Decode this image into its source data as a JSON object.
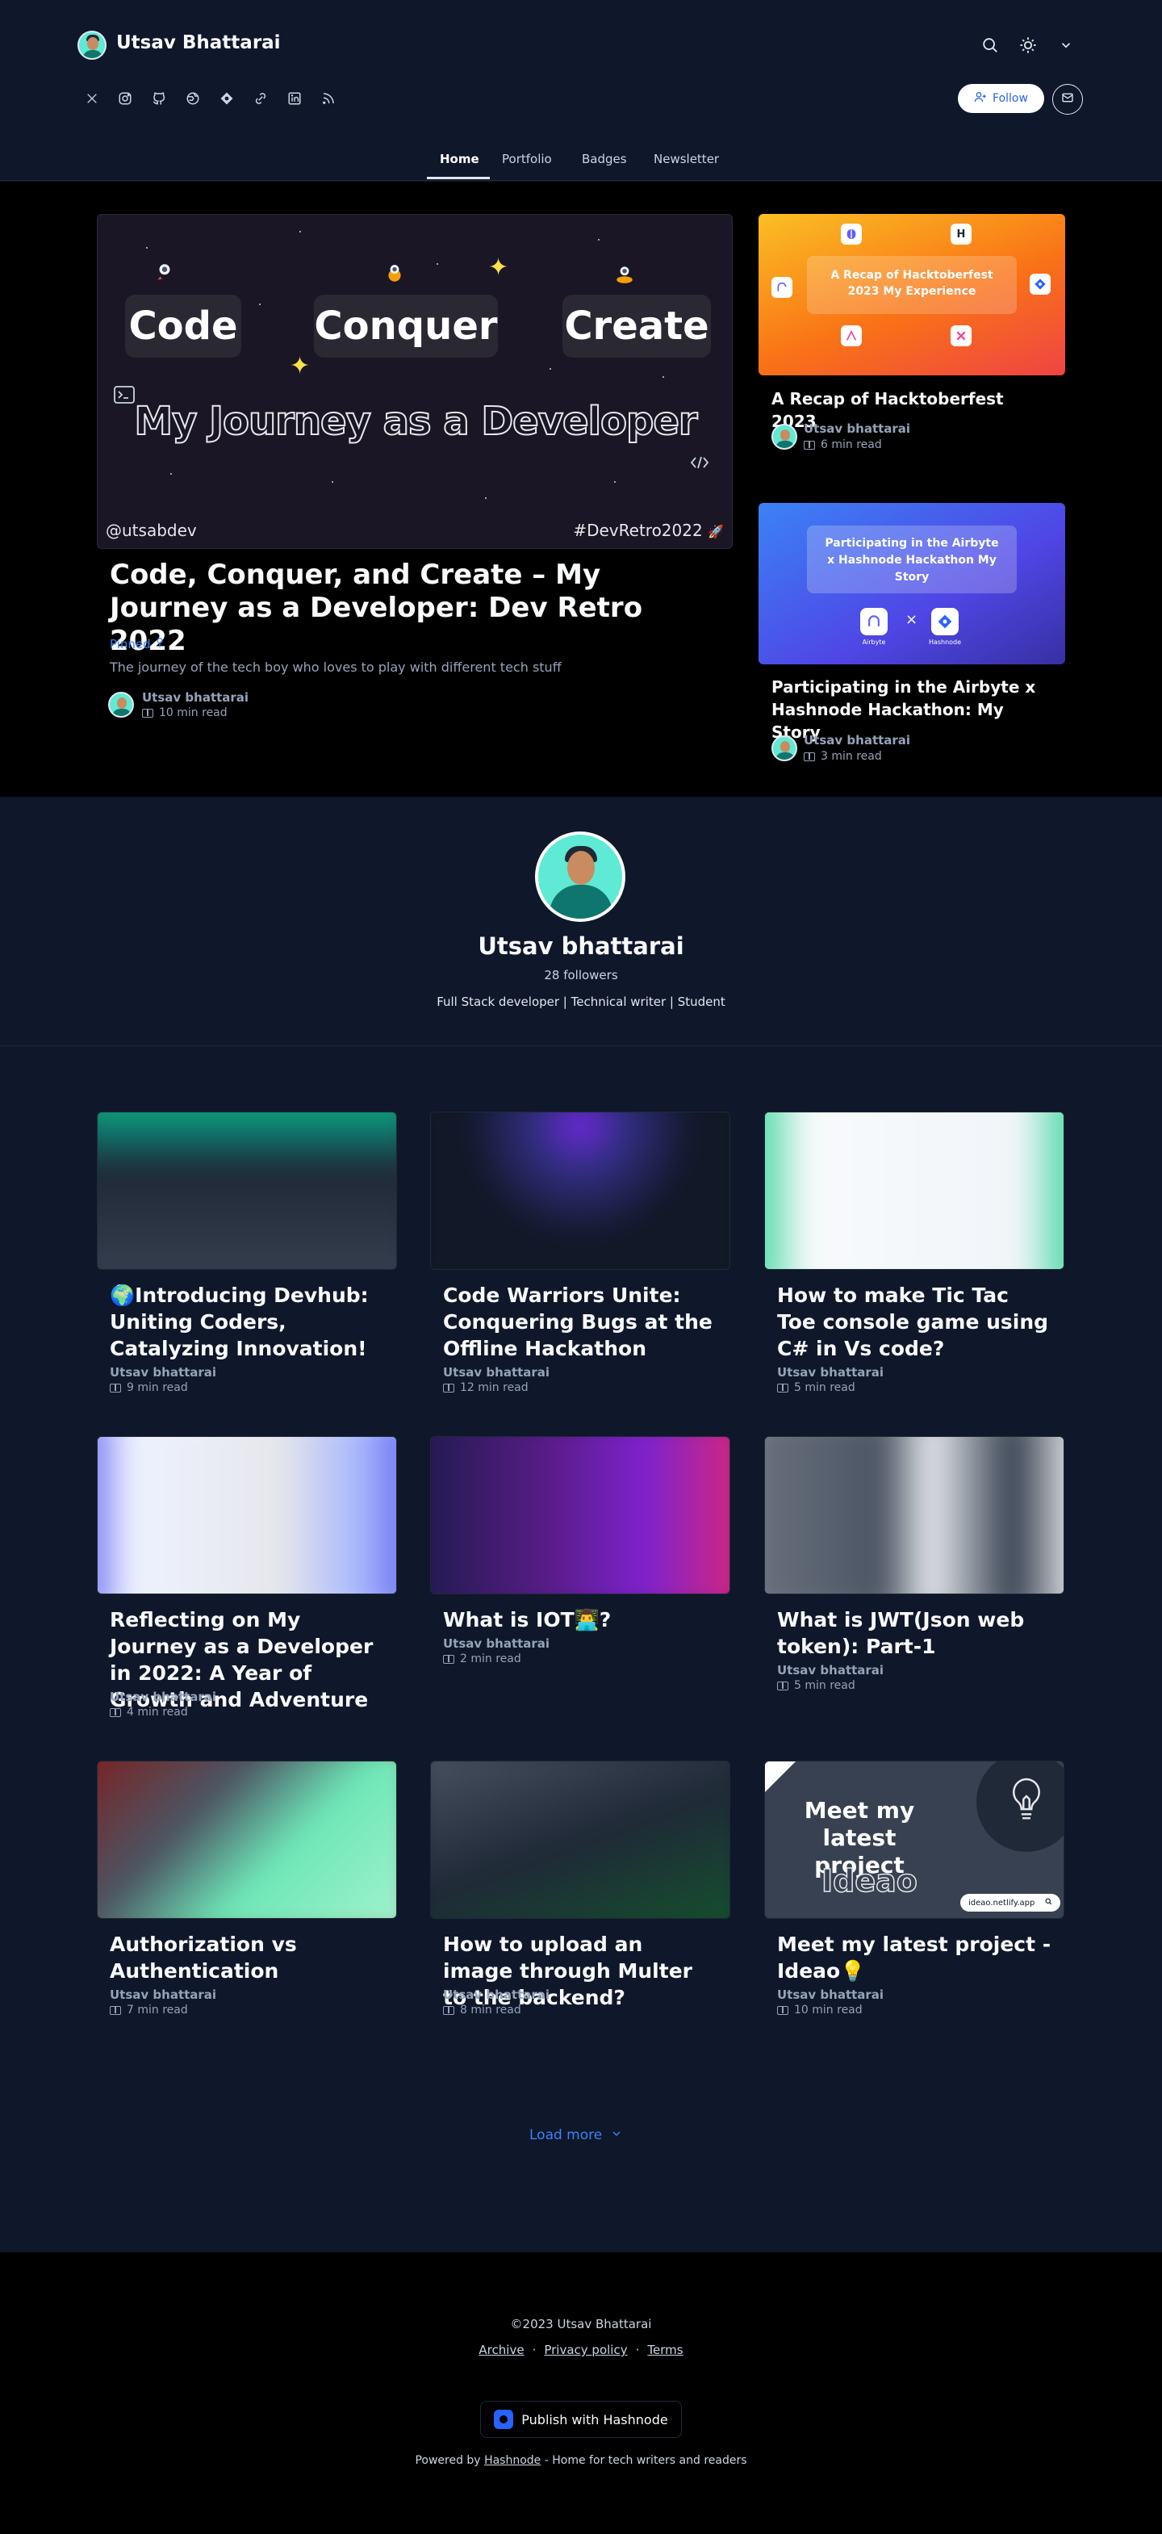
{
  "header": {
    "blog_title": "Utsav Bhattarai",
    "follow_label": "Follow",
    "nav": [
      "Home",
      "Portfolio",
      "Badges",
      "Newsletter"
    ]
  },
  "featured_main": {
    "image": {
      "words": [
        "Code",
        "Conquer",
        "Create"
      ],
      "headline": "My Journey as a Developer",
      "handle": "@utsabdev",
      "tag": "#DevRetro2022"
    },
    "title": "Code, Conquer, and Create – My Journey as a Developer: Dev Retro 2022",
    "pinned": "Pinned",
    "subtitle": "The journey of the tech boy who loves to play with different tech stuff",
    "author": "Utsav bhattarai",
    "read_time": "10 min read"
  },
  "featured_side": [
    {
      "image_text": "A Recap of Hacktoberfest 2023 My Experience",
      "title": "A Recap of Hacktoberfest 2023",
      "author": "Utsav bhattarai",
      "read_time": "6 min read"
    },
    {
      "image_text": "Participating in the Airbyte x Hashnode Hackathon My Story",
      "image_logos": [
        "Airbyte",
        "Hashnode"
      ],
      "title": "Participating in the Airbyte x Hashnode Hackathon: My Story",
      "author": "Utsav bhattarai",
      "read_time": "3 min read"
    }
  ],
  "profile": {
    "name": "Utsav bhattarai",
    "followers": "28 followers",
    "bio": "Full Stack developer | Technical writer | Student"
  },
  "posts": [
    {
      "title": "🌍Introducing Devhub: Uniting Coders, Catalyzing Innovation!",
      "author": "Utsav bhattarai",
      "read_time": "9 min read"
    },
    {
      "title": "Code Warriors Unite: Conquering Bugs at the Offline Hackathon",
      "author": "Utsav bhattarai",
      "read_time": "12 min read"
    },
    {
      "title": "How to make Tic Tac Toe console game using C# in Vs code?",
      "author": "Utsav bhattarai",
      "read_time": "5 min read"
    },
    {
      "title": "Reflecting on My Journey as a Developer in 2022: A Year of Growth and Adventure",
      "author": "Utsav bhattarai",
      "read_time": "4 min read"
    },
    {
      "title": "What is IOT👨‍💻?",
      "author": "Utsav bhattarai",
      "read_time": "2 min read"
    },
    {
      "title": "What is JWT(Json web token): Part-1",
      "author": "Utsav bhattarai",
      "read_time": "5 min read"
    },
    {
      "title": "Authorization vs Authentication",
      "author": "Utsav bhattarai",
      "read_time": "7 min read"
    },
    {
      "title": "How to upload an image through Multer to the backend?",
      "author": "Utsav bhattarai",
      "read_time": "8 min read"
    },
    {
      "title": "Meet my latest project - Ideao💡",
      "author": "Utsav bhattarai",
      "read_time": "10 min read"
    }
  ],
  "ideao_card": {
    "line1": "Meet my",
    "line2": "latest project",
    "name": "Ideao",
    "url": "ideao.netlify.app"
  },
  "load_more": "Load more",
  "footer": {
    "copyright": "©2023 Utsav Bhattarai",
    "links": [
      "Archive",
      "Privacy policy",
      "Terms"
    ],
    "publish_label": "Publish with Hashnode",
    "powered_prefix": "Powered by",
    "powered_link": "Hashnode",
    "powered_suffix": "- Home for tech writers and readers"
  },
  "colors": {
    "accent": "#3b82f6",
    "page_bg": "#0f172a",
    "featured_bg": "#000000"
  }
}
